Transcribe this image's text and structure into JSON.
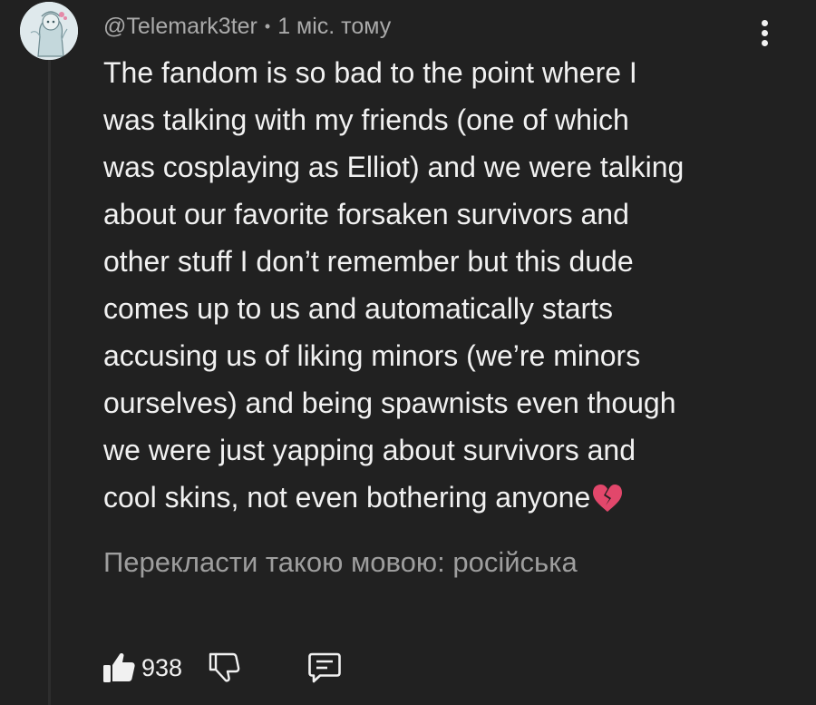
{
  "comment": {
    "author": "@Telemark3ter",
    "separator": "•",
    "timestamp": "1 міс. тому",
    "lines": [
      "The fandom is so bad to the point where I",
      "was talking with my friends (one of which",
      "was cosplaying as Elliot) and we were talking",
      "about our favorite forsaken survivors and",
      "other stuff I don’t remember but this dude",
      "comes up to us and automatically starts",
      "accusing us of liking minors (we’re minors",
      "ourselves) and being spawnists even though",
      "we were just yapping about survivors and",
      "cool skins, not even bothering anyone"
    ],
    "emoji": "broken-heart-icon",
    "translate_label": "Перекласти такою мовою: російська"
  },
  "actions": {
    "like_count": "938",
    "like_icon": "thumbs-up-icon",
    "dislike_icon": "thumbs-down-icon",
    "reply_icon": "comment-icon",
    "menu_icon": "more-vertical-icon"
  },
  "colors": {
    "background": "#212121",
    "text_primary": "#f1f1f1",
    "text_secondary": "#aaaaaa",
    "emoji": "#e2476b"
  }
}
